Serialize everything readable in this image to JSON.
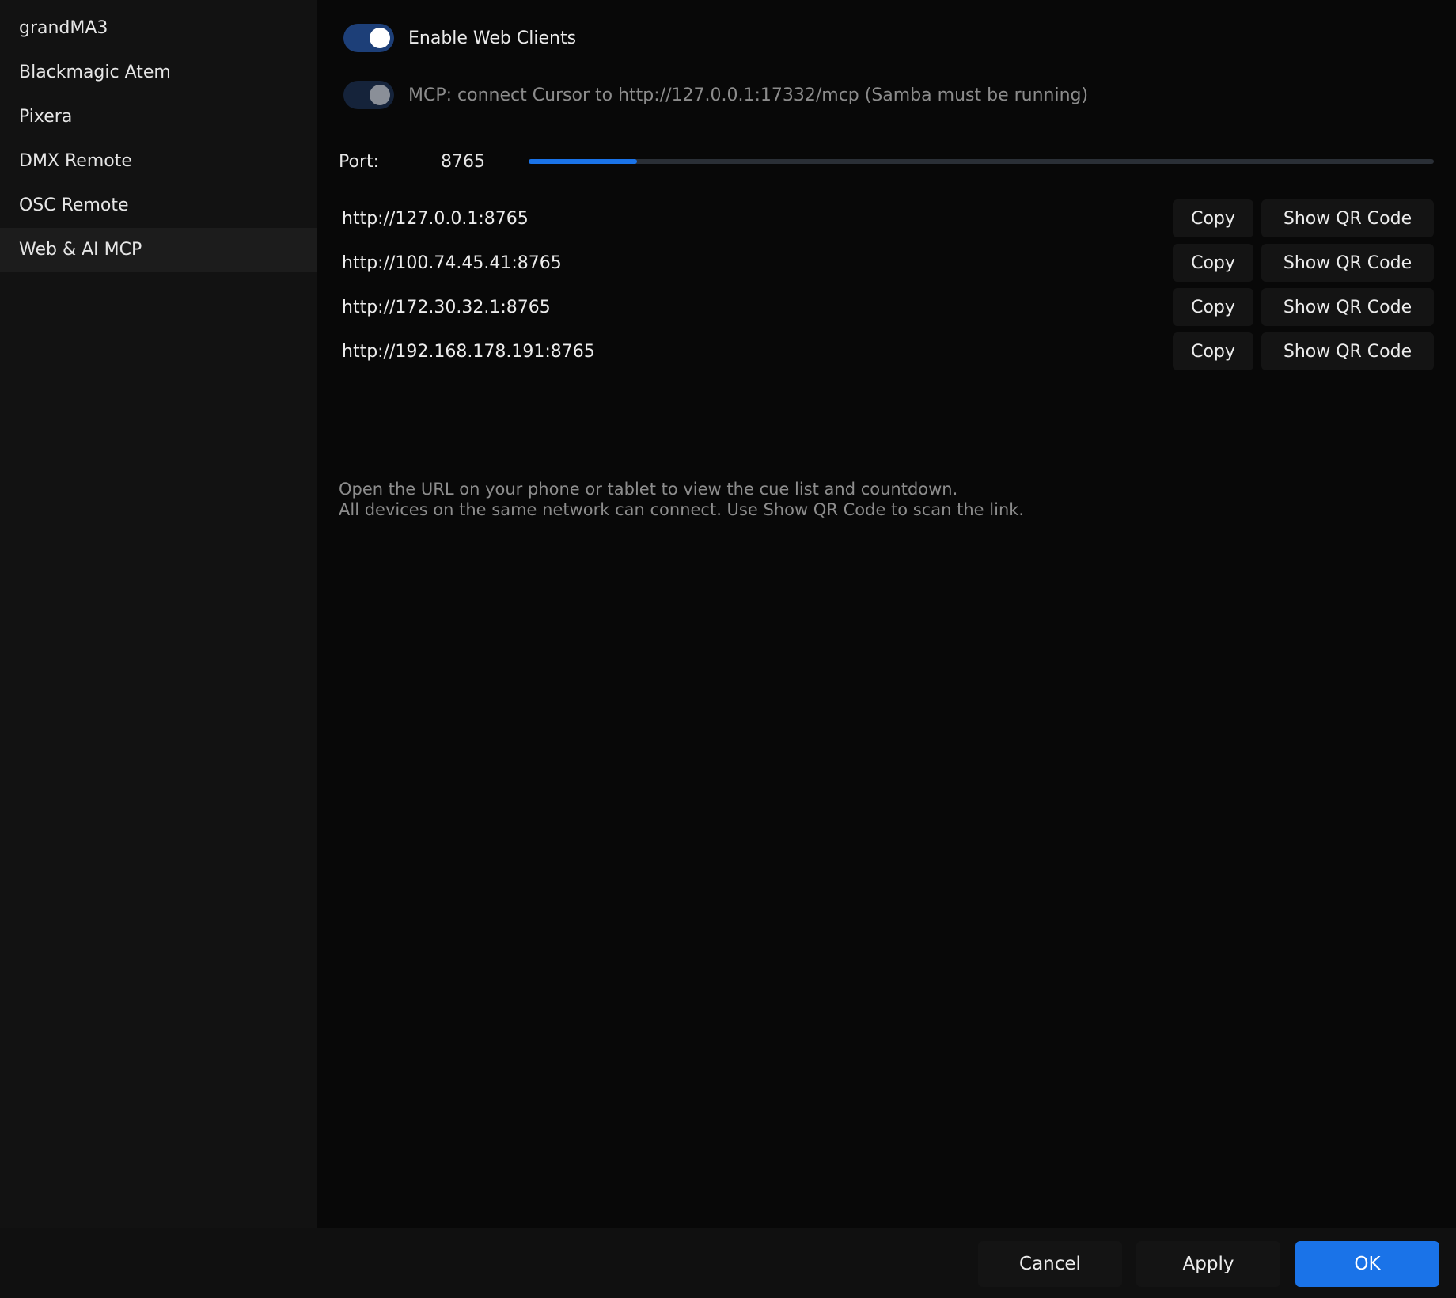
{
  "sidebar": {
    "items": [
      {
        "label": "grandMA3",
        "active": false
      },
      {
        "label": "Blackmagic Atem",
        "active": false
      },
      {
        "label": "Pixera",
        "active": false
      },
      {
        "label": "DMX Remote",
        "active": false
      },
      {
        "label": "OSC Remote",
        "active": false
      },
      {
        "label": "Web & AI MCP",
        "active": true
      }
    ]
  },
  "main": {
    "enable_web_clients": {
      "label": "Enable Web Clients",
      "on": true
    },
    "mcp": {
      "label": "MCP: connect Cursor to http://127.0.0.1:17332/mcp (Samba must be running)",
      "on": true,
      "disabled": true
    },
    "port": {
      "label": "Port:",
      "value": "8765",
      "slider_fraction": 0.12
    },
    "urls": [
      {
        "url": "http://127.0.0.1:8765",
        "copy_label": "Copy",
        "qr_label": "Show QR Code"
      },
      {
        "url": "http://100.74.45.41:8765",
        "copy_label": "Copy",
        "qr_label": "Show QR Code"
      },
      {
        "url": "http://172.30.32.1:8765",
        "copy_label": "Copy",
        "qr_label": "Show QR Code"
      },
      {
        "url": "http://192.168.178.191:8765",
        "copy_label": "Copy",
        "qr_label": "Show QR Code"
      }
    ],
    "help_line1": "Open the URL on your phone or tablet to view the cue list and countdown.",
    "help_line2": "All devices on the same network can connect. Use Show QR Code to scan the link."
  },
  "footer": {
    "cancel_label": "Cancel",
    "apply_label": "Apply",
    "ok_label": "OK"
  },
  "colors": {
    "accent": "#1a73e8",
    "toggle_on": "#1d3f78",
    "background": "#080808",
    "sidebar": "#121212"
  }
}
